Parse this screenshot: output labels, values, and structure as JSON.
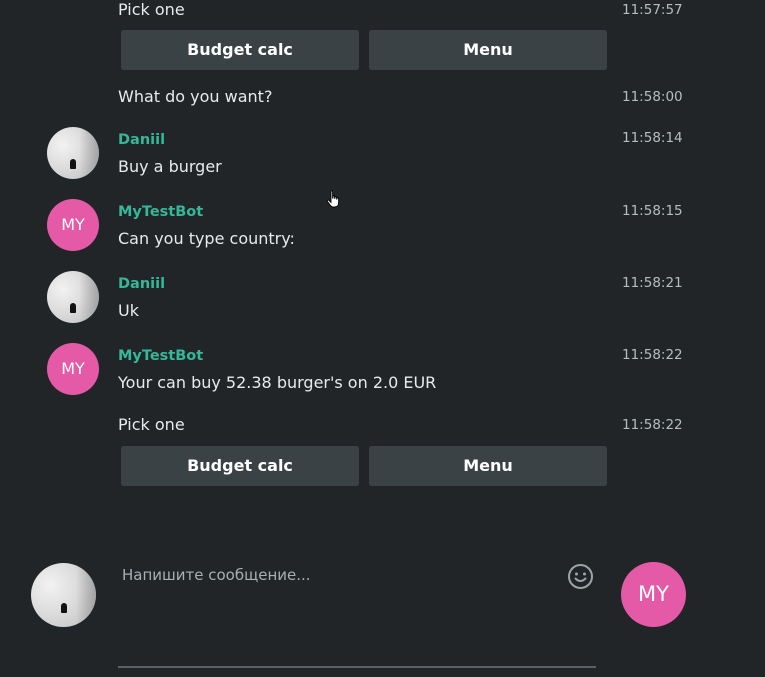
{
  "messages": [
    {
      "text": "Pick one",
      "time": "11:57:57"
    },
    {
      "text": "What do you want?",
      "time": "11:58:00"
    },
    {
      "sender": "Daniil",
      "text": "Buy a burger",
      "time": "11:58:14"
    },
    {
      "sender": "MyTestBot",
      "avatar_initials": "MY",
      "text": "Can you type country:",
      "time": "11:58:15"
    },
    {
      "sender": "Daniil",
      "text": "Uk",
      "time": "11:58:21"
    },
    {
      "sender": "MyTestBot",
      "avatar_initials": "MY",
      "text": "Your can buy 52.38 burger's on 2.0 EUR",
      "time": "11:58:22"
    },
    {
      "text": "Pick one",
      "time": "11:58:22"
    }
  ],
  "keyboard_top": {
    "budget_label": "Budget calc",
    "menu_label": "Menu"
  },
  "keyboard_bottom": {
    "budget_label": "Budget calc",
    "menu_label": "Menu"
  },
  "composer": {
    "placeholder": "Напишите сообщение...",
    "bot_avatar_initials": "MY",
    "emoji_icon": "smiley-icon"
  },
  "colors": {
    "background": "#212527",
    "sender_name": "#35b89a",
    "bot_avatar": "#e45aa7",
    "button": "#3b4245"
  }
}
